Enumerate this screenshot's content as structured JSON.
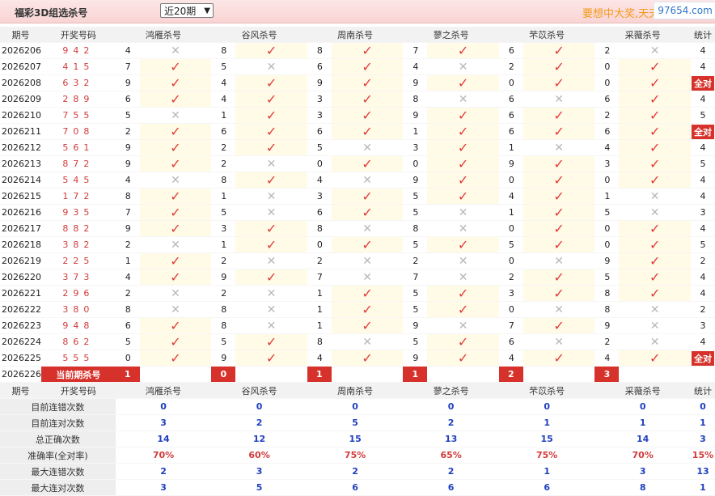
{
  "header": {
    "title": "福彩3D组选杀号",
    "period_select": "近20期",
    "slogan": "要想中大奖,天天",
    "watermark": "97654.com"
  },
  "columns": {
    "period": "期号",
    "number": "开奖号码",
    "experts": [
      "鸿雁杀号",
      "谷风杀号",
      "周南杀号",
      "蓼之杀号",
      "芣苡杀号",
      "采薇杀号"
    ],
    "stat": "统计"
  },
  "rows": [
    {
      "p": "2026206",
      "n": "942",
      "k": [
        [
          "4",
          0
        ],
        [
          "8",
          1
        ],
        [
          "8",
          1
        ],
        [
          "7",
          1
        ],
        [
          "6",
          1
        ],
        [
          "2",
          0
        ]
      ],
      "s": "4"
    },
    {
      "p": "2026207",
      "n": "415",
      "k": [
        [
          "7",
          1
        ],
        [
          "5",
          0
        ],
        [
          "6",
          1
        ],
        [
          "4",
          0
        ],
        [
          "2",
          1
        ],
        [
          "0",
          1
        ]
      ],
      "s": "4"
    },
    {
      "p": "2026208",
      "n": "632",
      "k": [
        [
          "9",
          1
        ],
        [
          "4",
          1
        ],
        [
          "9",
          1
        ],
        [
          "9",
          1
        ],
        [
          "0",
          1
        ],
        [
          "0",
          1
        ]
      ],
      "s": "全对"
    },
    {
      "p": "2026209",
      "n": "289",
      "k": [
        [
          "6",
          1
        ],
        [
          "4",
          1
        ],
        [
          "3",
          1
        ],
        [
          "8",
          0
        ],
        [
          "6",
          0
        ],
        [
          "6",
          1
        ]
      ],
      "s": "4"
    },
    {
      "p": "2026210",
      "n": "755",
      "k": [
        [
          "5",
          0
        ],
        [
          "1",
          1
        ],
        [
          "3",
          1
        ],
        [
          "9",
          1
        ],
        [
          "6",
          1
        ],
        [
          "2",
          1
        ]
      ],
      "s": "5"
    },
    {
      "p": "2026211",
      "n": "708",
      "k": [
        [
          "2",
          1
        ],
        [
          "6",
          1
        ],
        [
          "6",
          1
        ],
        [
          "1",
          1
        ],
        [
          "6",
          1
        ],
        [
          "6",
          1
        ]
      ],
      "s": "全对"
    },
    {
      "p": "2026212",
      "n": "561",
      "k": [
        [
          "9",
          1
        ],
        [
          "2",
          1
        ],
        [
          "5",
          0
        ],
        [
          "3",
          1
        ],
        [
          "1",
          0
        ],
        [
          "4",
          1
        ]
      ],
      "s": "4"
    },
    {
      "p": "2026213",
      "n": "872",
      "k": [
        [
          "9",
          1
        ],
        [
          "2",
          0
        ],
        [
          "0",
          1
        ],
        [
          "0",
          1
        ],
        [
          "9",
          1
        ],
        [
          "3",
          1
        ]
      ],
      "s": "5"
    },
    {
      "p": "2026214",
      "n": "545",
      "k": [
        [
          "4",
          0
        ],
        [
          "8",
          1
        ],
        [
          "4",
          0
        ],
        [
          "9",
          1
        ],
        [
          "0",
          1
        ],
        [
          "0",
          1
        ]
      ],
      "s": "4"
    },
    {
      "p": "2026215",
      "n": "172",
      "k": [
        [
          "8",
          1
        ],
        [
          "1",
          0
        ],
        [
          "3",
          1
        ],
        [
          "5",
          1
        ],
        [
          "4",
          1
        ],
        [
          "1",
          0
        ]
      ],
      "s": "4"
    },
    {
      "p": "2026216",
      "n": "935",
      "k": [
        [
          "7",
          1
        ],
        [
          "5",
          0
        ],
        [
          "6",
          1
        ],
        [
          "5",
          0
        ],
        [
          "1",
          1
        ],
        [
          "5",
          0
        ]
      ],
      "s": "3"
    },
    {
      "p": "2026217",
      "n": "882",
      "k": [
        [
          "9",
          1
        ],
        [
          "3",
          1
        ],
        [
          "8",
          0
        ],
        [
          "8",
          0
        ],
        [
          "0",
          1
        ],
        [
          "0",
          1
        ]
      ],
      "s": "4"
    },
    {
      "p": "2026218",
      "n": "382",
      "k": [
        [
          "2",
          0
        ],
        [
          "1",
          1
        ],
        [
          "0",
          1
        ],
        [
          "5",
          1
        ],
        [
          "5",
          1
        ],
        [
          "0",
          1
        ]
      ],
      "s": "5"
    },
    {
      "p": "2026219",
      "n": "225",
      "k": [
        [
          "1",
          1
        ],
        [
          "2",
          0
        ],
        [
          "2",
          0
        ],
        [
          "2",
          0
        ],
        [
          "0",
          0
        ],
        [
          "9",
          1
        ]
      ],
      "s": "2"
    },
    {
      "p": "2026220",
      "n": "373",
      "k": [
        [
          "4",
          1
        ],
        [
          "9",
          1
        ],
        [
          "7",
          0
        ],
        [
          "7",
          0
        ],
        [
          "2",
          1
        ],
        [
          "5",
          1
        ]
      ],
      "s": "4"
    },
    {
      "p": "2026221",
      "n": "296",
      "k": [
        [
          "2",
          0
        ],
        [
          "2",
          0
        ],
        [
          "1",
          1
        ],
        [
          "5",
          1
        ],
        [
          "3",
          1
        ],
        [
          "8",
          1
        ]
      ],
      "s": "4"
    },
    {
      "p": "2026222",
      "n": "380",
      "k": [
        [
          "8",
          0
        ],
        [
          "8",
          0
        ],
        [
          "1",
          1
        ],
        [
          "5",
          1
        ],
        [
          "0",
          0
        ],
        [
          "8",
          0
        ]
      ],
      "s": "2"
    },
    {
      "p": "2026223",
      "n": "948",
      "k": [
        [
          "6",
          1
        ],
        [
          "8",
          0
        ],
        [
          "1",
          1
        ],
        [
          "9",
          0
        ],
        [
          "7",
          1
        ],
        [
          "9",
          0
        ]
      ],
      "s": "3"
    },
    {
      "p": "2026224",
      "n": "862",
      "k": [
        [
          "5",
          1
        ],
        [
          "5",
          1
        ],
        [
          "8",
          0
        ],
        [
          "5",
          1
        ],
        [
          "6",
          0
        ],
        [
          "2",
          0
        ]
      ],
      "s": "4"
    },
    {
      "p": "2026225",
      "n": "555",
      "k": [
        [
          "0",
          1
        ],
        [
          "9",
          1
        ],
        [
          "4",
          1
        ],
        [
          "9",
          1
        ],
        [
          "4",
          1
        ],
        [
          "4",
          1
        ]
      ],
      "s": "全对"
    }
  ],
  "current": {
    "p": "2026226",
    "label": "当前期杀号",
    "k": [
      "1",
      "0",
      "1",
      "1",
      "2",
      "3"
    ]
  },
  "stats": [
    {
      "label": "目前连错次数",
      "v": [
        "0",
        "0",
        "0",
        "0",
        "0",
        "0",
        "0"
      ],
      "red": false
    },
    {
      "label": "目前连对次数",
      "v": [
        "3",
        "2",
        "5",
        "2",
        "1",
        "1",
        "1"
      ],
      "red": false
    },
    {
      "label": "总正确次数",
      "v": [
        "14",
        "12",
        "15",
        "13",
        "15",
        "14",
        "3"
      ],
      "red": false
    },
    {
      "label": "准确率(全对率)",
      "v": [
        "70%",
        "60%",
        "75%",
        "65%",
        "75%",
        "70%",
        "15%"
      ],
      "red": true
    },
    {
      "label": "最大连错次数",
      "v": [
        "2",
        "3",
        "2",
        "2",
        "1",
        "3",
        "13"
      ],
      "red": false
    },
    {
      "label": "最大连对次数",
      "v": [
        "3",
        "5",
        "6",
        "6",
        "6",
        "8",
        "1"
      ],
      "red": false
    }
  ],
  "icons": {
    "correct": "check-icon",
    "wrong": "cross-icon"
  },
  "colors": {
    "accent": "#d6322b",
    "check": "#e23a3a",
    "stat_blue": "#1f3fbf"
  }
}
